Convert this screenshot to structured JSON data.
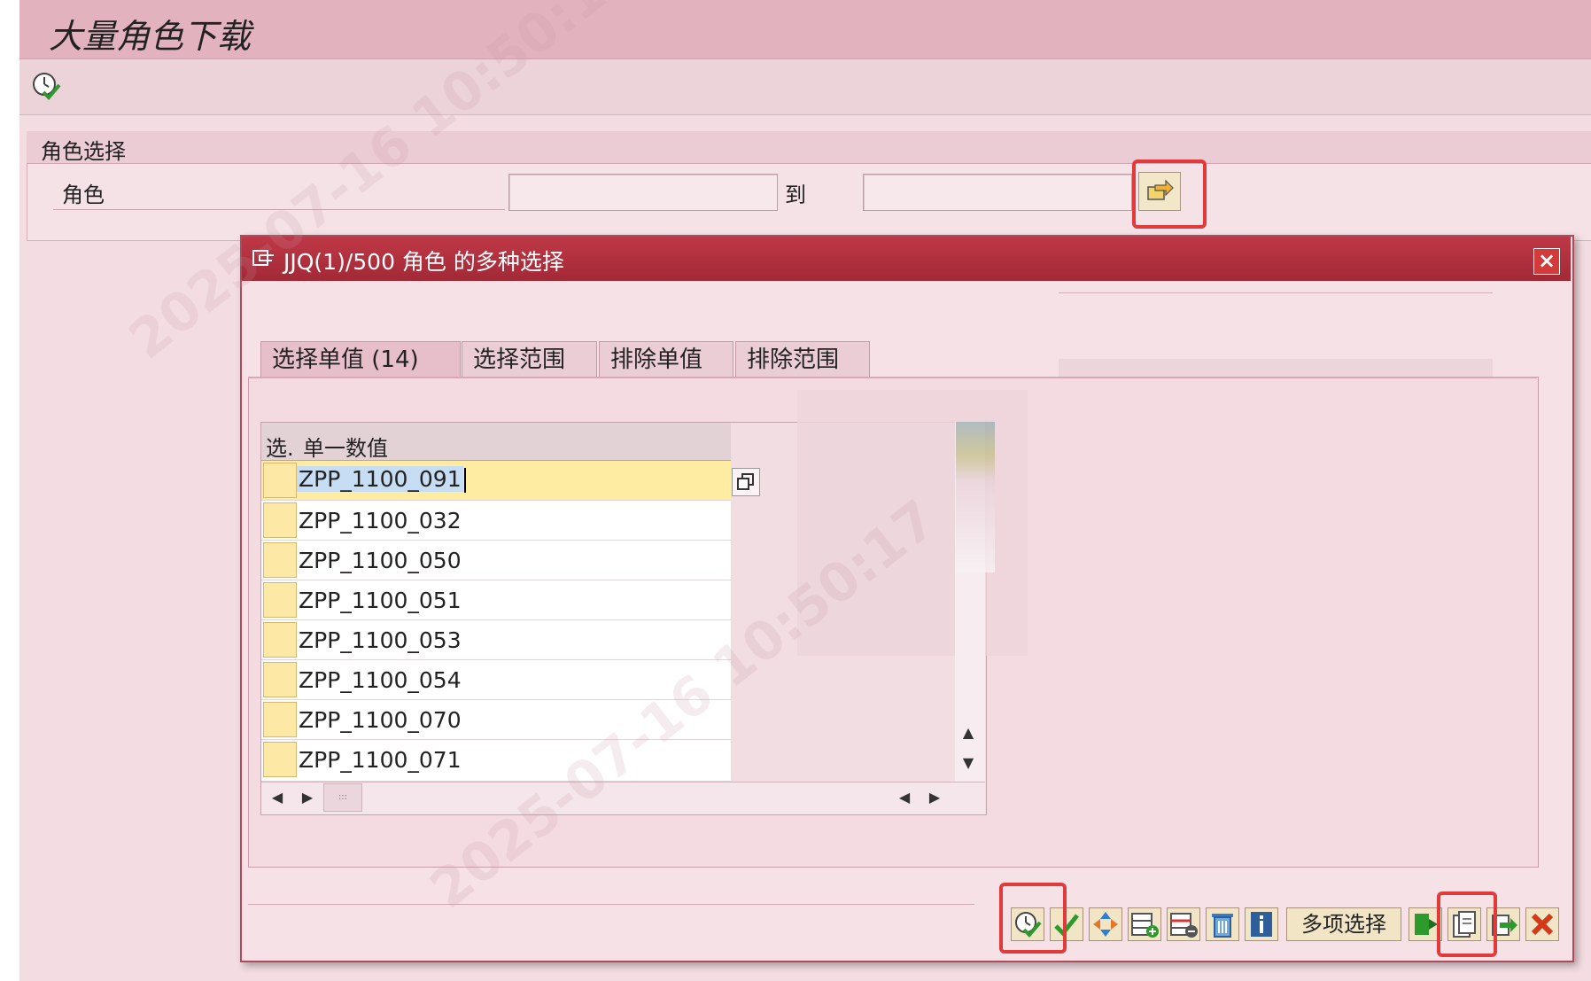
{
  "window": {
    "title": "大量角色下载"
  },
  "selection_group": {
    "title": "角色选择",
    "field_label": "角色",
    "from_value": "",
    "to_label": "到",
    "to_value": ""
  },
  "dialog": {
    "title": "JJQ(1)/500 角色 的多种选择",
    "tabs": [
      {
        "label": "选择单值 (14)",
        "active": true
      },
      {
        "label": "选择范围",
        "active": false
      },
      {
        "label": "排除单值",
        "active": false
      },
      {
        "label": "排除范围",
        "active": false
      }
    ],
    "table": {
      "col_select": "选.",
      "col_value": "单一数值",
      "rows": [
        "ZPP_1100_091",
        "ZPP_1100_032",
        "ZPP_1100_050",
        "ZPP_1100_051",
        "ZPP_1100_053",
        "ZPP_1100_054",
        "ZPP_1100_070",
        "ZPP_1100_071"
      ]
    },
    "toolbar": {
      "multi_select_label": "多项选择"
    }
  },
  "watermark": "2025-07-16 10:50:17"
}
